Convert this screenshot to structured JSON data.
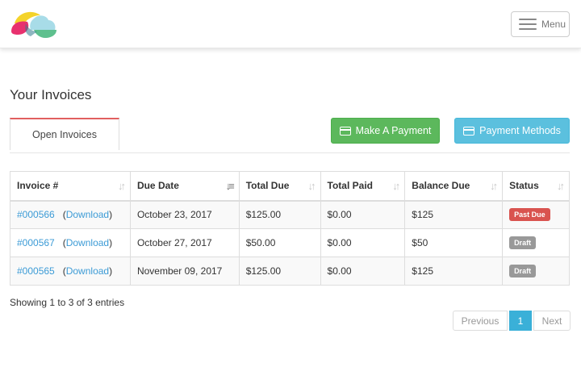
{
  "header": {
    "menu_label": "Menu"
  },
  "page": {
    "title": "Your Invoices"
  },
  "tabs": [
    {
      "label": "Open Invoices"
    }
  ],
  "actions": {
    "make_payment": "Make A Payment",
    "payment_methods": "Payment Methods"
  },
  "table": {
    "columns": [
      "Invoice #",
      "Due Date",
      "Total Due",
      "Total Paid",
      "Balance Due",
      "Status"
    ],
    "rows": [
      {
        "invoice": "#000566",
        "download": "Download",
        "due_date": "October 23, 2017",
        "total_due": "$125.00",
        "total_paid": "$0.00",
        "balance": "$125",
        "status": "Past Due"
      },
      {
        "invoice": "#000567",
        "download": "Download",
        "due_date": "October 27, 2017",
        "total_due": "$50.00",
        "total_paid": "$0.00",
        "balance": "$50",
        "status": "Draft"
      },
      {
        "invoice": "#000565",
        "download": "Download",
        "due_date": "November 09, 2017",
        "total_due": "$125.00",
        "total_paid": "$0.00",
        "balance": "$125",
        "status": "Draft"
      }
    ]
  },
  "footer": {
    "info": "Showing 1 to 3 of 3 entries",
    "pagination": {
      "previous": "Previous",
      "current": "1",
      "next": "Next"
    }
  },
  "colors": {
    "success": "#5cb85c",
    "info": "#5bc0de",
    "danger": "#d9534f",
    "link": "#3c9bd6",
    "tab_accent": "#e15f5f"
  }
}
